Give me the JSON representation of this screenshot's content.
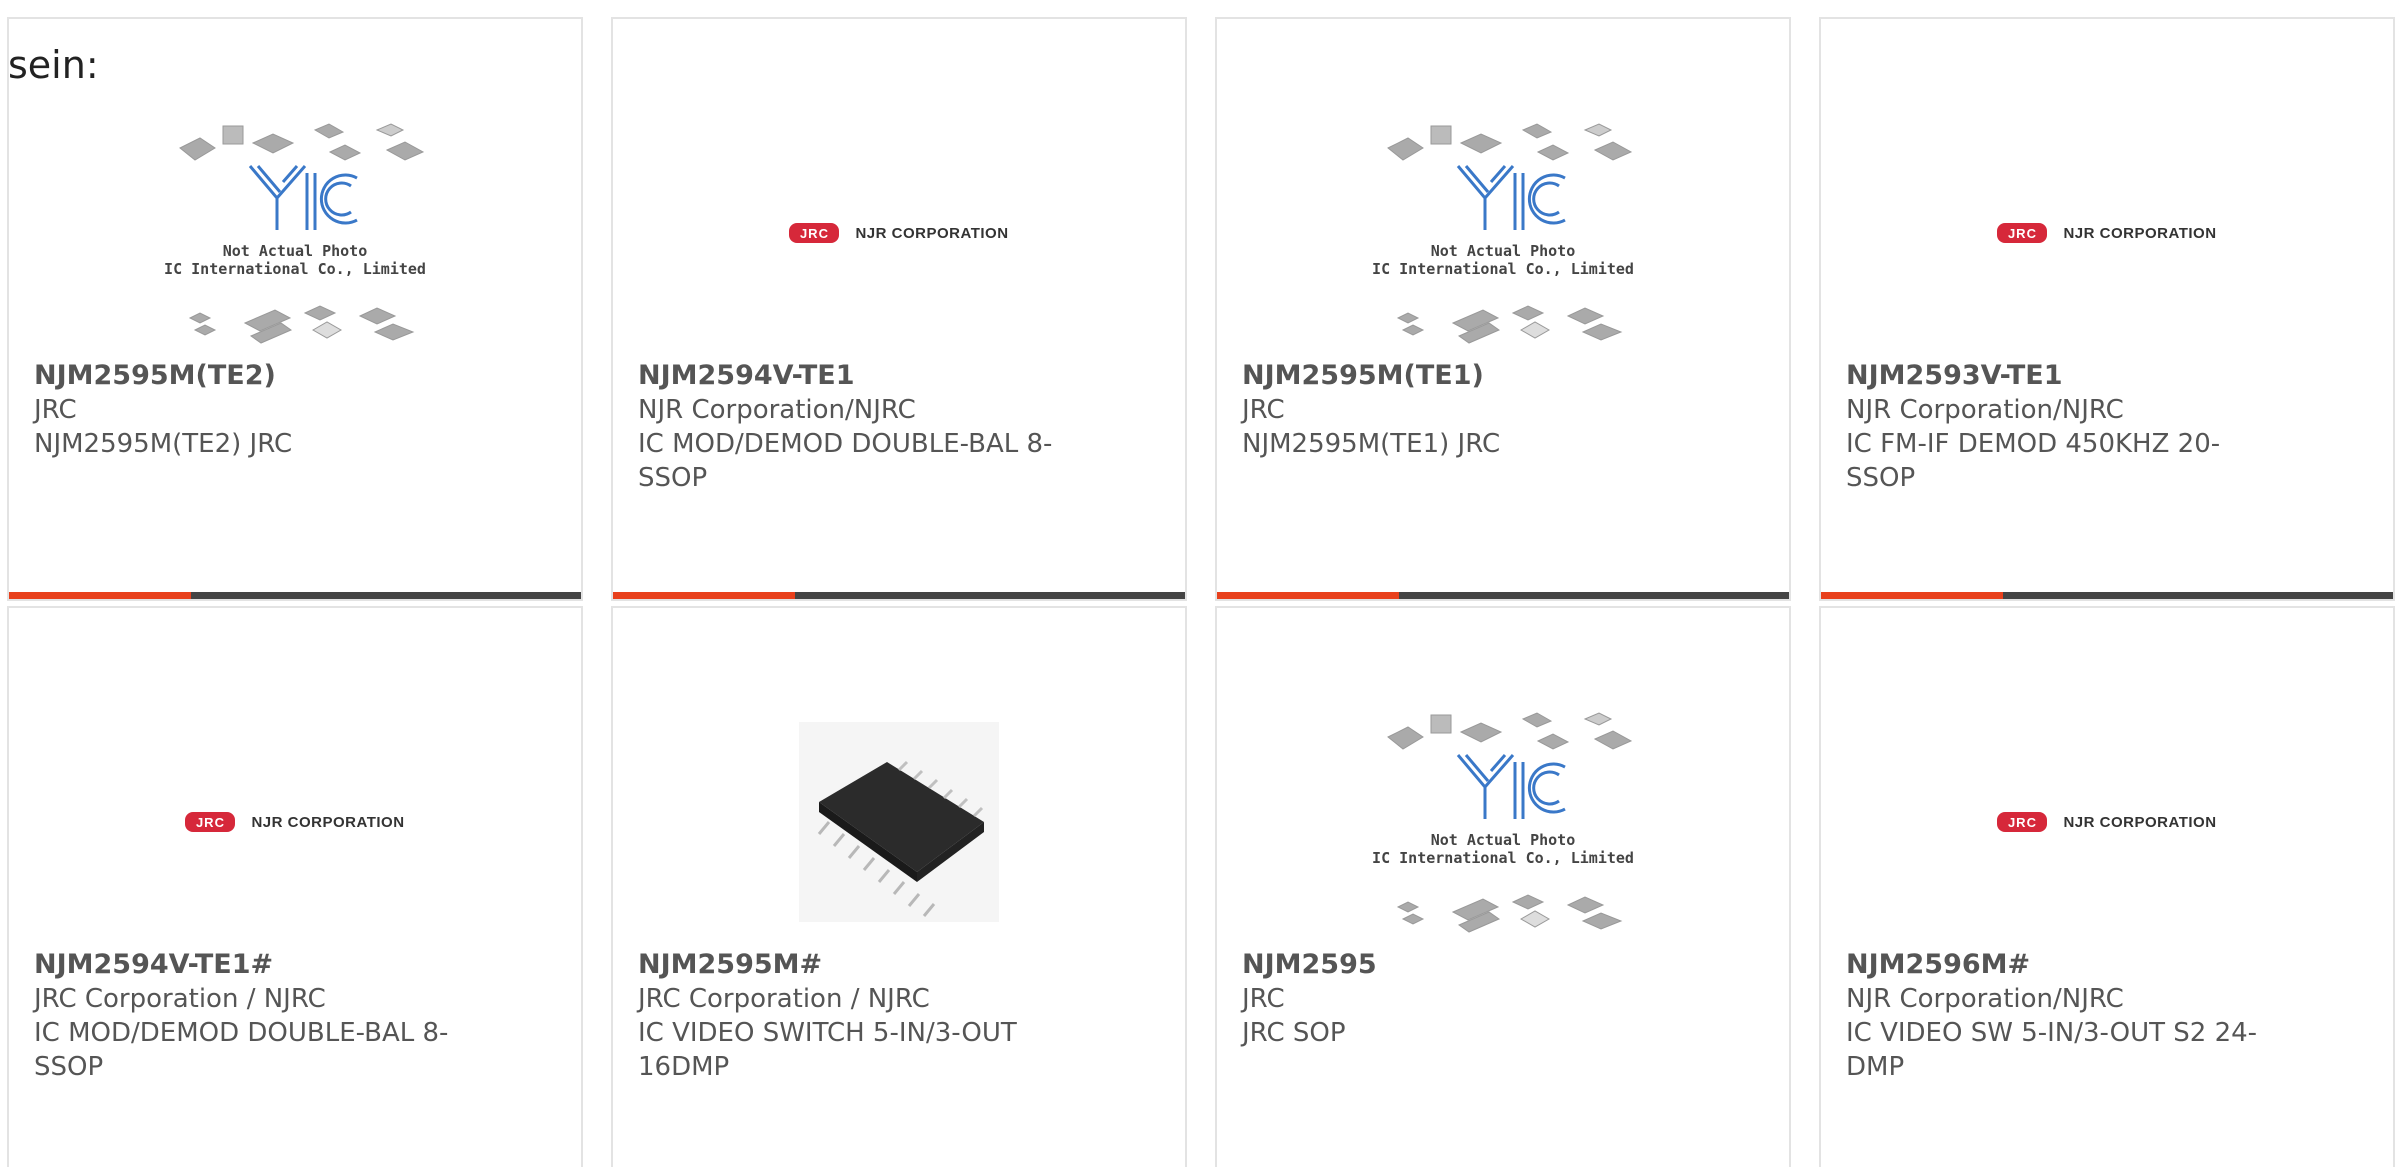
{
  "intro_text": "sein:",
  "colors": {
    "accent": "#e8401c",
    "bar": "#444444",
    "border": "#e3e3e3",
    "text": "#555555",
    "jrc_red": "#d6283a",
    "yic_blue": "#3a78c8"
  },
  "placeholder": {
    "caption_line1": "Not Actual Photo",
    "caption_line2": "YIC International Co., Limited.",
    "logo_text": "YIC"
  },
  "njr_logo": {
    "badge": "JRC",
    "text": "NJR CORPORATION"
  },
  "products": [
    {
      "part": "NJM2595M(TE2)",
      "manufacturer": "JRC",
      "description": "NJM2595M(TE2) JRC",
      "image": "yic-placeholder"
    },
    {
      "part": "NJM2594V-TE1",
      "manufacturer": "NJR Corporation/NJRC",
      "description": "IC MOD/DEMOD DOUBLE-BAL 8-SSOP",
      "image": "njr-logo"
    },
    {
      "part": "NJM2595M(TE1)",
      "manufacturer": "JRC",
      "description": "NJM2595M(TE1) JRC",
      "image": "yic-placeholder"
    },
    {
      "part": "NJM2593V-TE1",
      "manufacturer": "NJR Corporation/NJRC",
      "description": "IC FM-IF DEMOD 450KHZ 20-SSOP",
      "image": "njr-logo"
    },
    {
      "part": "NJM2594V-TE1#",
      "manufacturer": "JRC Corporation / NJRC",
      "description": "IC MOD/DEMOD DOUBLE-BAL 8-SSOP",
      "image": "njr-logo"
    },
    {
      "part": "NJM2595M#",
      "manufacturer": "JRC Corporation / NJRC",
      "description": "IC VIDEO SWITCH 5-IN/3-OUT 16DMP",
      "image": "chip-photo"
    },
    {
      "part": "NJM2595",
      "manufacturer": "JRC",
      "description": "JRC SOP",
      "image": "yic-placeholder"
    },
    {
      "part": "NJM2596M#",
      "manufacturer": "NJR Corporation/NJRC",
      "description": "IC VIDEO SW 5-IN/3-OUT S2 24-DMP",
      "image": "njr-logo"
    }
  ]
}
